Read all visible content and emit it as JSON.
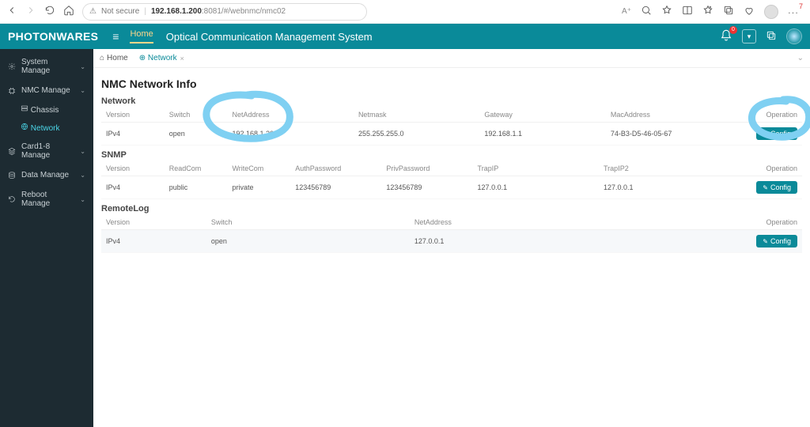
{
  "browser": {
    "insecure_label": "Not secure",
    "url_host": "192.168.1.200",
    "url_port_path": ":8081/#/webnmc/nmc02",
    "notif_count": "7"
  },
  "topbar": {
    "brand": "PHOTONWARES",
    "home": "Home",
    "title": "Optical Communication Management System",
    "bell_badge": "0"
  },
  "sidebar": {
    "items": [
      {
        "label": "System Manage",
        "icon": "gear"
      },
      {
        "label": "NMC Manage",
        "icon": "cpu"
      },
      {
        "label": "Card1-8 Manage",
        "icon": "layers"
      },
      {
        "label": "Data Manage",
        "icon": "database"
      },
      {
        "label": "Reboot Manage",
        "icon": "refresh"
      }
    ],
    "nmc_sub": [
      {
        "label": "Chassis",
        "icon": "server"
      },
      {
        "label": "Network",
        "icon": "globe",
        "active": true
      }
    ]
  },
  "breadcrumb": {
    "home": "Home",
    "tab": "Network",
    "home_icon": "⌂",
    "tab_icon": "⊕"
  },
  "page": {
    "title": "NMC Network Info",
    "network": {
      "title": "Network",
      "headers": [
        "Version",
        "Switch",
        "NetAddress",
        "Netmask",
        "Gateway",
        "MacAddress",
        "Operation"
      ],
      "row": {
        "version": "IPv4",
        "switch": "open",
        "netaddress": "192.168.1.200",
        "netmask": "255.255.255.0",
        "gateway": "192.168.1.1",
        "mac": "74-B3-D5-46-05-67",
        "op": "Config"
      }
    },
    "snmp": {
      "title": "SNMP",
      "headers": [
        "Version",
        "ReadCom",
        "WriteCom",
        "AuthPassword",
        "PrivPassword",
        "TrapIP",
        "TrapIP2",
        "Operation"
      ],
      "row": {
        "version": "IPv4",
        "read": "public",
        "write": "private",
        "auth": "123456789",
        "priv": "123456789",
        "trap": "127.0.0.1",
        "trap2": "127.0.0.1",
        "op": "Config"
      }
    },
    "remotelog": {
      "title": "RemoteLog",
      "headers": [
        "Version",
        "Switch",
        "NetAddress",
        "Operation"
      ],
      "row": {
        "version": "IPv4",
        "switch": "open",
        "netaddress": "127.0.0.1",
        "op": "Config"
      }
    }
  }
}
